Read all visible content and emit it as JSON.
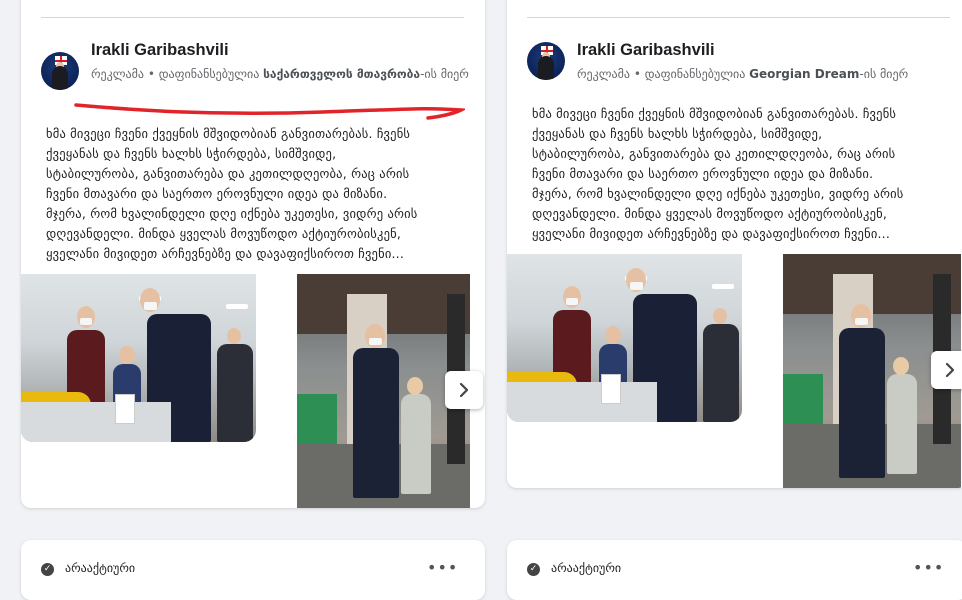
{
  "left_post": {
    "author": "Irakli Garibashvili",
    "sponsor_prefix": "რეკლამა • დაფინანსებულია ",
    "sponsor_name": "საქართველოს მთავრობა",
    "sponsor_suffix": "-ის მიერ",
    "body": "ხმა მივეცი ჩვენი ქვეყნის მშვიდობიან განვითარებას. ჩვენს\nქვეყანას და ჩვენს ხალხს სჭირდება, სიმშვიდე,\nსტაბილურობა, განვითარება და კეთილდღეობა, რაც არის\nჩვენი მთავარი და საერთო ეროვნული იდეა და მიზანი.\nმჯერა, რომ ხვალინდელი დღე იქნება უკეთესი, ვიდრე არის\nდღევანდელი. მინდა ყველას მოვუწოდო აქტიურობისკენ,\nყველანი მივიდეთ არჩევნებზე და დავაფიქსიროთ ჩვენი..."
  },
  "right_post": {
    "author": "Irakli Garibashvili",
    "sponsor_prefix": "რეკლამა • დაფინანსებულია ",
    "sponsor_name": "Georgian Dream",
    "sponsor_suffix": "-ის მიერ",
    "body": "ხმა მივეცი ჩვენი ქვეყნის მშვიდობიან განვითარებას. ჩვენს\nქვეყანას და ჩვენს ხალხს სჭირდება, სიმშვიდე,\nსტაბილურობა, განვითარება და კეთილდღეობა, რაც არის\nჩვენი მთავარი და საერთო ეროვნული იდეა და მიზანი.\nმჯერა, რომ ხვალინდელი დღე იქნება უკეთესი, ვიდრე არის\nდღევანდელი. მინდა ყველას მოვუწოდო აქტიურობისკენ,\nყველანი მივიდეთ არჩევნებზე და დავაფიქსიროთ ჩვენი..."
  },
  "bottom_cards": {
    "left_label": "არააქტიური",
    "right_label": "არააქტიური",
    "more_icon": "•••"
  },
  "icons": {
    "next": "chevron-right-icon",
    "status": "check-circle-icon"
  },
  "colors": {
    "highlight_red": "#e0242a",
    "background": "#f0f2f5"
  }
}
